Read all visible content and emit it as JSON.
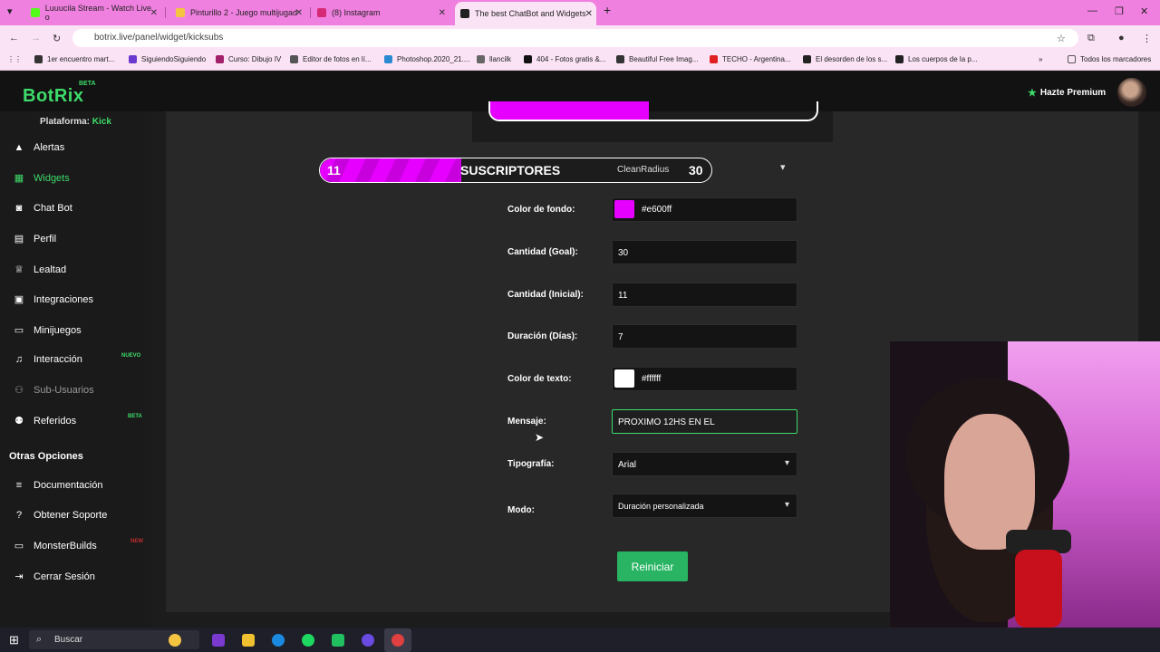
{
  "browser": {
    "tabs": [
      {
        "title": "Luuucila Stream - Watch Live o",
        "color": "#53fc18"
      },
      {
        "title": "Pinturillo 2 - Juego multijugad",
        "color": "#f5c542"
      },
      {
        "title": "(8) Instagram",
        "color": "#d62976"
      },
      {
        "title": "The best ChatBot and Widgets",
        "color": "#222222"
      }
    ],
    "url": "botrix.live/panel/widget/kicksubs",
    "bookmarks": [
      "1er encuentro mart...",
      "SiguiendoSiguiendo",
      "Curso: Dibujo IV",
      "Editor de fotos en lí...",
      "Photoshop.2020_21....",
      "llancilk",
      "404 - Fotos gratis &...",
      "Beautiful Free Imag...",
      "TECHO - Argentina...",
      "El desorden de los s...",
      "Los cuerpos de la p..."
    ],
    "all_bookmarks": "Todos los marcadores"
  },
  "app": {
    "logo": "BotRix",
    "logo_badge": "BETA",
    "premium": "Hazte Premium",
    "accent": "#3ddc6a"
  },
  "sidebar": {
    "platform_label": "Plataforma:",
    "platform_value": "Kick",
    "items": [
      {
        "label": "Alertas",
        "icon": "warning-icon"
      },
      {
        "label": "Widgets",
        "icon": "widgets-icon",
        "active": true
      },
      {
        "label": "Chat Bot",
        "icon": "robot-icon"
      },
      {
        "label": "Perfil",
        "icon": "profile-icon"
      },
      {
        "label": "Lealtad",
        "icon": "trophy-icon"
      },
      {
        "label": "Integraciones",
        "icon": "integrations-icon"
      },
      {
        "label": "Minijuegos",
        "icon": "gamepad-icon"
      },
      {
        "label": "Interacción",
        "icon": "music-icon",
        "badge": "NUEVO"
      },
      {
        "label": "Sub-Usuarios",
        "icon": "users-icon",
        "disabled": true
      },
      {
        "label": "Referidos",
        "icon": "referrals-icon",
        "badge": "BETA"
      }
    ],
    "section_title": "Otras Opciones",
    "other_items": [
      {
        "label": "Documentación",
        "icon": "docs-icon"
      },
      {
        "label": "Obtener Soporte",
        "icon": "help-icon"
      },
      {
        "label": "MonsterBuilds",
        "icon": "monitor-icon",
        "badge": "NEW"
      },
      {
        "label": "Cerrar Sesión",
        "icon": "logout-icon"
      }
    ]
  },
  "widget": {
    "preview": {
      "current": "11",
      "message": "SUSCRIPTORES",
      "user": "CleanRadius",
      "goal": "30",
      "progress_fraction": 0.36
    },
    "fields": {
      "bg_color_label": "Color de fondo:",
      "bg_color_value": "#e600ff",
      "goal_label": "Cantidad (Goal):",
      "goal_value": "30",
      "initial_label": "Cantidad (Inicial):",
      "initial_value": "11",
      "duration_label": "Duración (Días):",
      "duration_value": "7",
      "text_color_label": "Color de texto:",
      "text_color_value": "#ffffff",
      "message_label": "Mensaje:",
      "message_value": "PROXIMO 12HS EN EL",
      "font_label": "Tipografía:",
      "font_value": "Arial",
      "mode_label": "Modo:",
      "mode_value": "Duración personalizada"
    },
    "restart_button": "Reiniciar"
  },
  "taskbar": {
    "search_placeholder": "Buscar"
  }
}
